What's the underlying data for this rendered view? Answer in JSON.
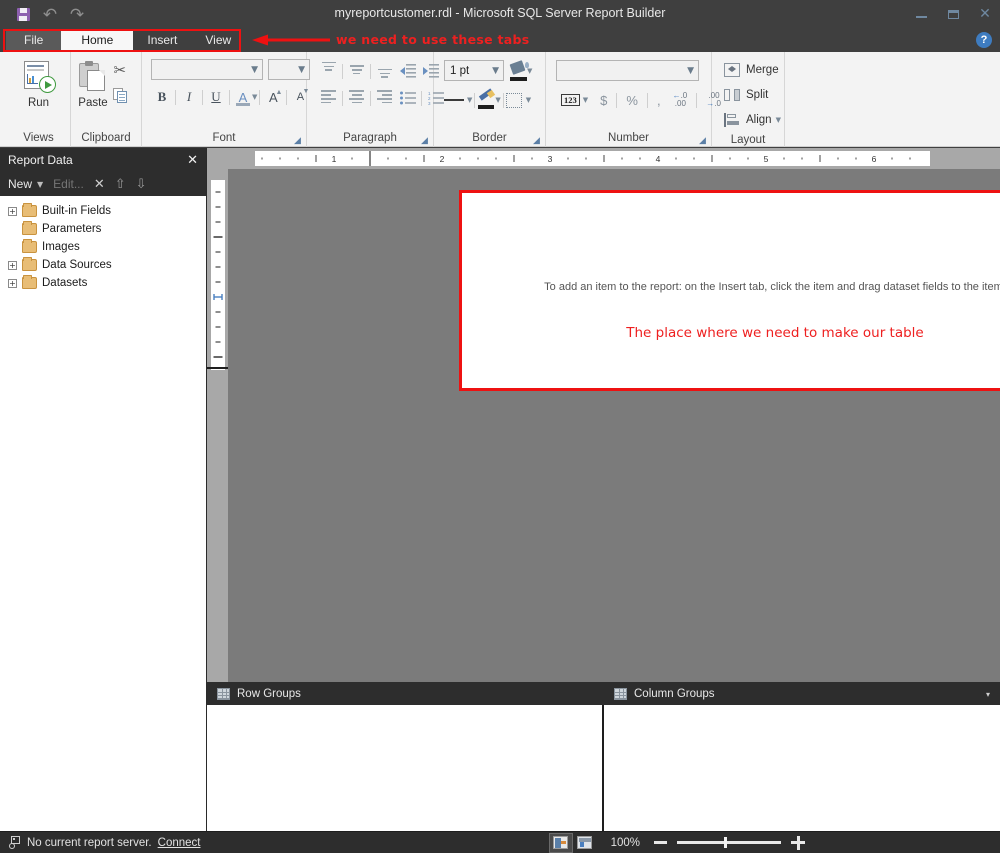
{
  "window": {
    "title": "myreportcustomer.rdl - Microsoft SQL Server Report Builder",
    "minimize_label": "Minimize",
    "maximize_label": "Restore",
    "close_label": "Close",
    "help_label": "?"
  },
  "quick_access": {
    "save_label": "Save",
    "undo_label": "Undo",
    "redo_label": "Redo",
    "undo_glyph": "↶",
    "redo_glyph": "↷"
  },
  "tabs": [
    {
      "label": "File",
      "state": "file"
    },
    {
      "label": "Home",
      "state": "active"
    },
    {
      "label": "Insert",
      "state": "normal"
    },
    {
      "label": "View",
      "state": "normal"
    }
  ],
  "annotations": {
    "tabs_note": "we need to use these tabs",
    "canvas_note": "The place where we need to make our table",
    "highlight_color": "#ee1111",
    "text_color": "#ee2020"
  },
  "ribbon": {
    "groups": [
      {
        "name": "Views",
        "label": "Views",
        "buttons": [
          {
            "label": "Run",
            "icon": "run-report-icon"
          }
        ]
      },
      {
        "name": "Clipboard",
        "label": "Clipboard",
        "buttons": [
          {
            "label": "Paste",
            "icon": "paste-icon"
          },
          {
            "label": "Cut",
            "icon": "cut-icon"
          },
          {
            "label": "Copy",
            "icon": "copy-icon"
          }
        ]
      },
      {
        "name": "Font",
        "label": "Font",
        "font_family_value": "",
        "font_size_value": "",
        "buttons": [
          {
            "label": "Bold",
            "glyph": "B"
          },
          {
            "label": "Italic",
            "glyph": "I"
          },
          {
            "label": "Underline",
            "glyph": "U"
          },
          {
            "label": "Font Color",
            "glyph": "A"
          },
          {
            "label": "Increase Font Size",
            "glyph": "A"
          },
          {
            "label": "Decrease Font Size",
            "glyph": "A"
          }
        ]
      },
      {
        "name": "Paragraph",
        "label": "Paragraph",
        "buttons": [
          {
            "label": "Align Top"
          },
          {
            "label": "Align Middle"
          },
          {
            "label": "Align Bottom"
          },
          {
            "label": "Decrease Indent"
          },
          {
            "label": "Increase Indent"
          },
          {
            "label": "Align Left"
          },
          {
            "label": "Align Center"
          },
          {
            "label": "Align Right"
          },
          {
            "label": "Bullets"
          },
          {
            "label": "Numbering"
          }
        ]
      },
      {
        "name": "Border",
        "label": "Border",
        "border_width_value": "1 pt",
        "buttons": [
          {
            "label": "Fill Color",
            "icon": "paint-bucket-icon"
          },
          {
            "label": "Line Style",
            "icon": "line-style-icon"
          },
          {
            "label": "Border Color",
            "icon": "pencil-icon"
          },
          {
            "label": "Borders",
            "icon": "border-box-icon"
          }
        ]
      },
      {
        "name": "Number",
        "label": "Number",
        "number_format_value": "",
        "buttons": [
          {
            "label": "Number Format",
            "glyph": "123"
          },
          {
            "label": "Currency",
            "glyph": "$"
          },
          {
            "label": "Percent",
            "glyph": "%"
          },
          {
            "label": "Comma",
            "glyph": ","
          },
          {
            "label": "Decrease Decimals"
          },
          {
            "label": "Increase Decimals"
          }
        ]
      },
      {
        "name": "Layout",
        "label": "Layout",
        "buttons": [
          {
            "label": "Merge",
            "icon": "merge-cells-icon"
          },
          {
            "label": "Split",
            "icon": "split-cells-icon"
          },
          {
            "label": "Align",
            "icon": "align-objects-icon"
          }
        ]
      }
    ]
  },
  "report_data": {
    "title": "Report Data",
    "close_label": "✕",
    "toolbar": {
      "new_label": "New",
      "edit_label": "Edit...",
      "delete_label": "✕",
      "up_label": "⇧",
      "down_label": "⇩"
    },
    "tree": [
      {
        "label": "Built-in Fields",
        "expandable": true
      },
      {
        "label": "Parameters",
        "expandable": false
      },
      {
        "label": "Images",
        "expandable": false
      },
      {
        "label": "Data Sources",
        "expandable": true
      },
      {
        "label": "Datasets",
        "expandable": true
      }
    ]
  },
  "design_surface": {
    "ruler_h_marks": [
      "1",
      "2",
      "3",
      "4",
      "5",
      "6"
    ],
    "body_hint": "To add an item to the report: on the Insert tab, click the item and drag dataset fields to the item."
  },
  "groups_pane": {
    "row_groups_label": "Row Groups",
    "column_groups_label": "Column Groups",
    "caret": "▾"
  },
  "status_bar": {
    "server_text": "No current report server.",
    "connect_label": "Connect",
    "zoom_value": "100%",
    "design_view_label": "Design View",
    "print_layout_label": "Print Layout"
  }
}
